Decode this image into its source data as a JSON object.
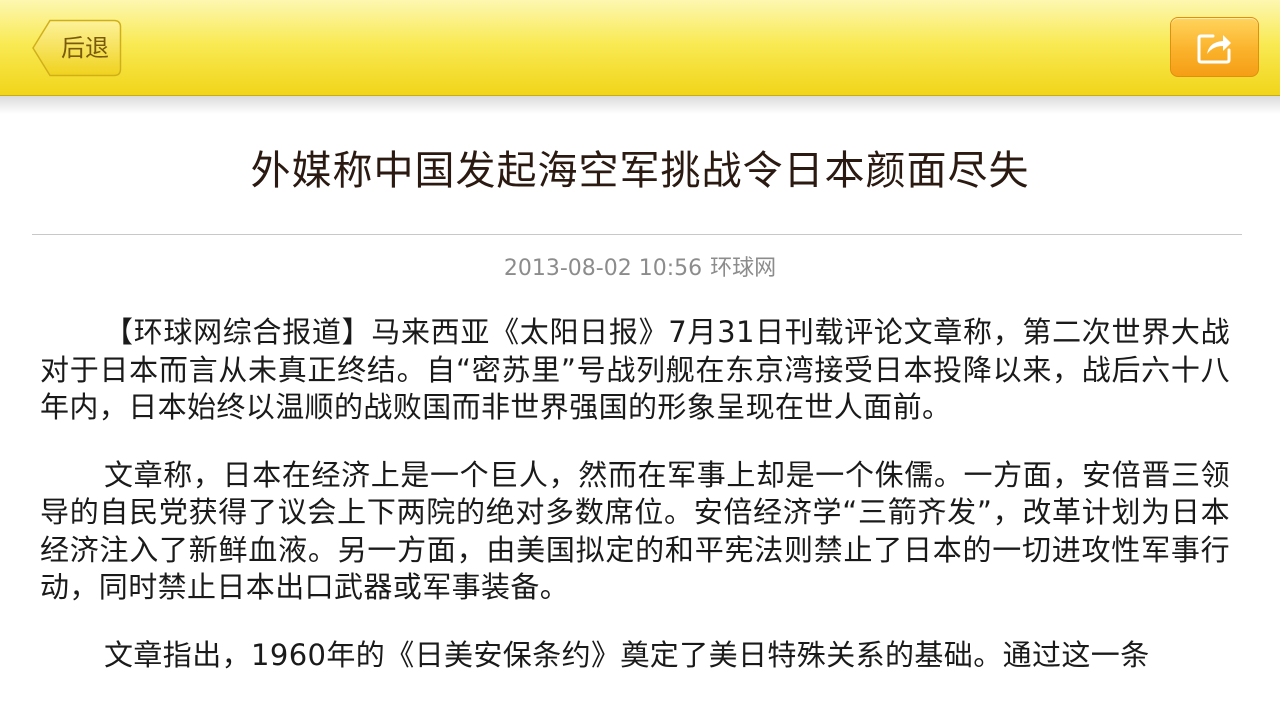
{
  "header": {
    "back_label": "后退",
    "share_icon": "share-icon",
    "colors": {
      "bar_top": "#fdf7b0",
      "bar_bottom": "#f1d51a",
      "share_button": "#fbb22b"
    }
  },
  "article": {
    "title": "外媒称中国发起海空军挑战令日本颜面尽失",
    "date": "2013-08-02 10:56",
    "source": "环球网",
    "paragraphs": [
      "【环球网综合报道】马来西亚《太阳日报》7月31日刊载评论文章称，第二次世界大战对于日本而言从未真正终结。自“密苏里”号战列舰在东京湾接受日本投降以来，战后六十八年内，日本始终以温顺的战败国而非世界强国的形象呈现在世人面前。",
      "文章称，日本在经济上是一个巨人，然而在军事上却是一个侏儒。一方面，安倍晋三领导的自民党获得了议会上下两院的绝对多数席位。安倍经济学“三箭齐发”，改革计划为日本经济注入了新鲜血液。另一方面，由美国拟定的和平宪法则禁止了日本的一切进攻性军事行动，同时禁止日本出口武器或军事装备。",
      "文章指出，1960年的《日美安保条约》奠定了美日特殊关系的基础。通过这一条"
    ]
  }
}
